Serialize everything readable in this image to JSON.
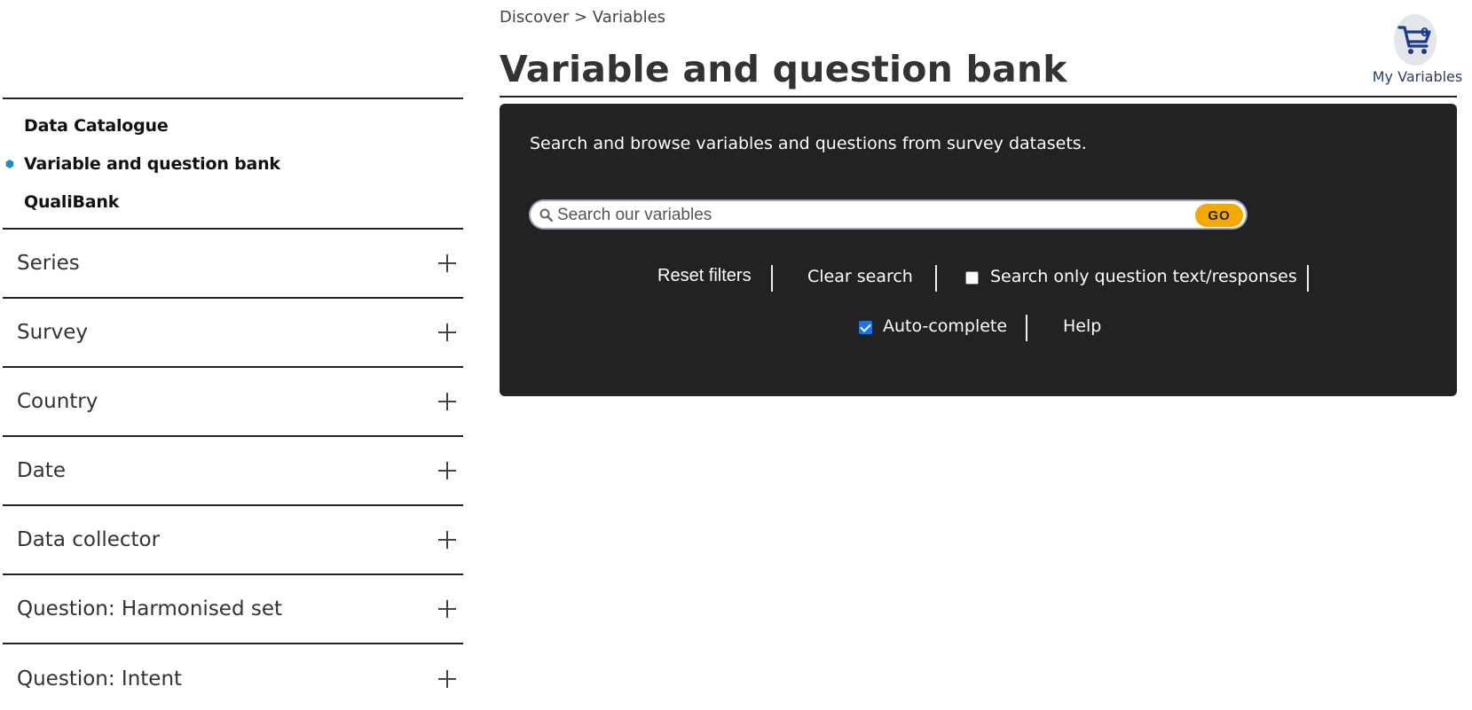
{
  "breadcrumb": "Discover > Variables",
  "page_title": "Variable and question bank",
  "basket": {
    "count": "0",
    "label": "My Variables"
  },
  "nav": {
    "items": [
      {
        "label": "Data Catalogue",
        "active": false
      },
      {
        "label": "Variable and question bank",
        "active": true
      },
      {
        "label": "QualiBank",
        "active": false
      }
    ]
  },
  "facets": [
    {
      "label": "Series"
    },
    {
      "label": "Survey"
    },
    {
      "label": "Country"
    },
    {
      "label": "Date"
    },
    {
      "label": "Data collector"
    },
    {
      "label": "Question: Harmonised set"
    },
    {
      "label": "Question: Intent"
    }
  ],
  "search": {
    "intro": "Search and browse variables and questions from survey datasets.",
    "placeholder": "Search our variables",
    "go_label": "GO",
    "reset_label": "Reset filters",
    "clear_label": "Clear search",
    "question_only_label": "Search only question text/responses",
    "question_only_checked": false,
    "autocomplete_label": "Auto-complete",
    "autocomplete_checked": true,
    "help_label": "Help"
  },
  "colors": {
    "panel_bg": "#222222",
    "go_button": "#f2a900",
    "active_dot": "#1e90c8",
    "checkbox_on": "#1a73e8"
  }
}
